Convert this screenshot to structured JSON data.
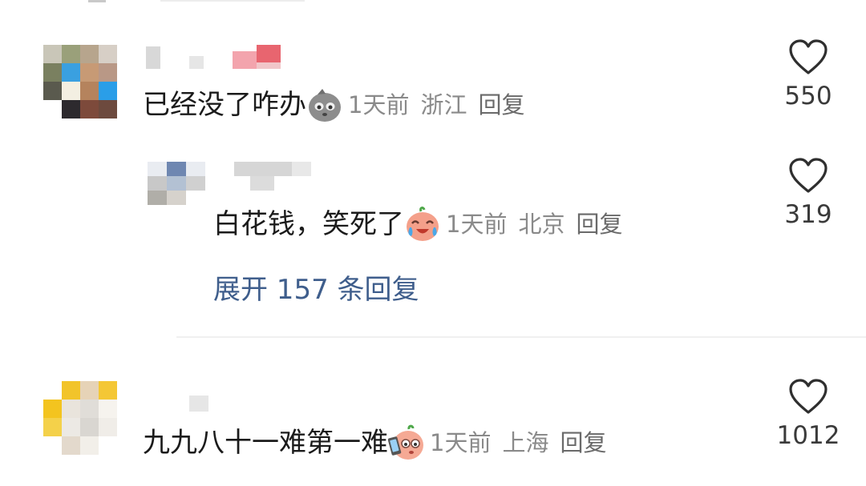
{
  "comments": [
    {
      "text": "已经没了咋办",
      "emoji": "sad-face-emoji",
      "time": "1天前",
      "location": "浙江",
      "reply_label": "回复",
      "likes": "550",
      "replies": [
        {
          "text": "白花钱，笑死了",
          "emoji": "laughing-crying-emoji",
          "time": "1天前",
          "location": "北京",
          "reply_label": "回复",
          "likes": "319"
        }
      ],
      "expand_label": "展开 157 条回复"
    },
    {
      "text": "九九八十一难第一难",
      "emoji": "phone-crying-emoji",
      "time": "1天前",
      "location": "上海",
      "reply_label": "回复",
      "likes": "1012"
    }
  ],
  "colors": {
    "link": "#3f5e8c",
    "meta": "#8a8a8a",
    "text": "#1b1b1b"
  }
}
